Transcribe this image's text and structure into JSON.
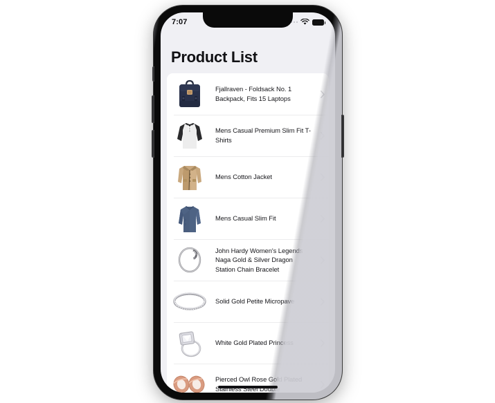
{
  "status_bar": {
    "time": "7:07",
    "signal_icon": "signal-dots-icon",
    "wifi_icon": "wifi-icon",
    "battery_icon": "battery-full-icon"
  },
  "header": {
    "title": "Product List"
  },
  "colors": {
    "screen_background": "#f0f0f4",
    "card_background": "#ffffff",
    "title_text": "#111114",
    "item_text": "#16161a",
    "divider": "#ececed",
    "chevron": "#d2d2d6",
    "frame": "#0a0a0a"
  },
  "products": [
    {
      "title": "Fjallraven - Foldsack No. 1 Backpack, Fits 15 Laptops",
      "image": "navy-backpack-thumbnail",
      "chevron": "chevron-right-icon"
    },
    {
      "title": "Mens Casual Premium Slim Fit T-Shirts",
      "image": "raglan-tshirt-thumbnail",
      "chevron": "chevron-right-icon"
    },
    {
      "title": "Mens Cotton Jacket",
      "image": "tan-cotton-jacket-thumbnail",
      "chevron": "chevron-right-icon"
    },
    {
      "title": "Mens Casual Slim Fit",
      "image": "blue-slim-fit-shirt-thumbnail",
      "chevron": "chevron-right-icon"
    },
    {
      "title": "John Hardy Women's Legends Naga Gold & Silver Dragon Station Chain Bracelet",
      "image": "silver-chain-bracelet-thumbnail",
      "chevron": "chevron-right-icon"
    },
    {
      "title": "Solid Gold Petite Micropave",
      "image": "silver-eternity-band-thumbnail",
      "chevron": "chevron-right-icon"
    },
    {
      "title": "White Gold Plated Princess",
      "image": "halo-engagement-ring-thumbnail",
      "chevron": "chevron-right-icon"
    },
    {
      "title": "Pierced Owl Rose Gold Plated Stainless Steel Double",
      "image": "rose-gold-tunnel-earrings-thumbnail",
      "chevron": "chevron-right-icon"
    }
  ],
  "home_indicator": "home-indicator-bar"
}
